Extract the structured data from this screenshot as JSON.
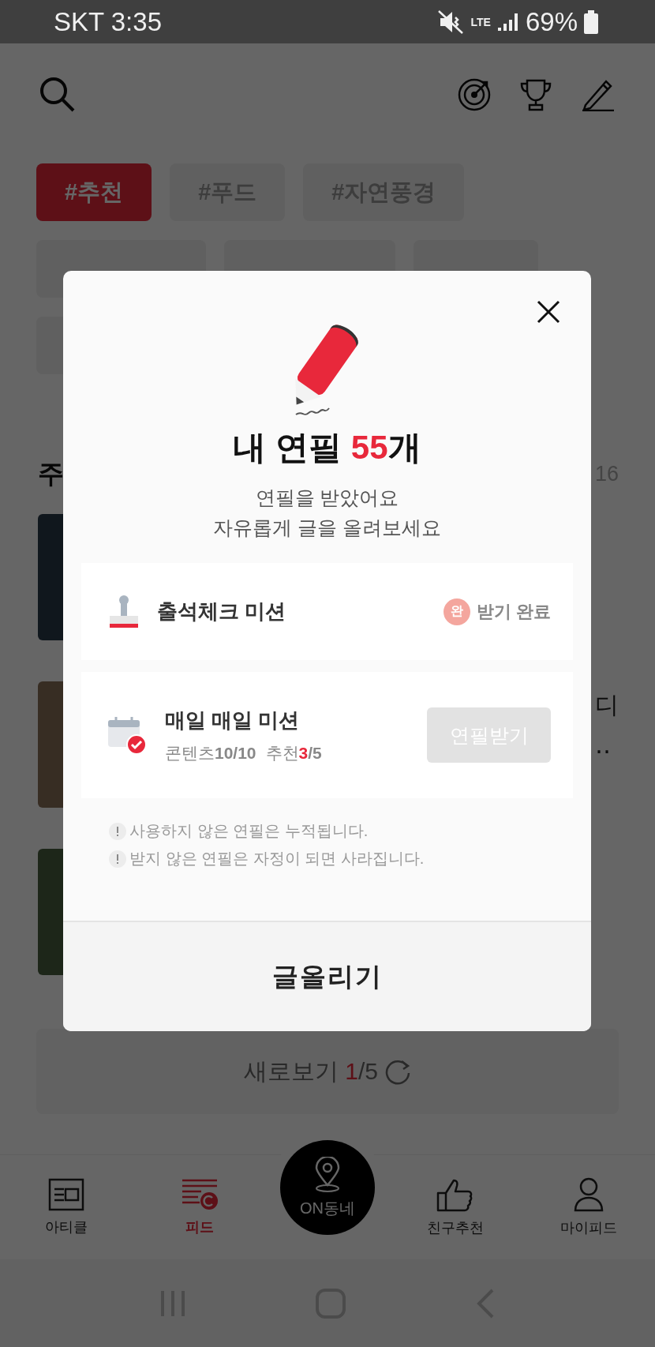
{
  "status_bar": {
    "carrier_time": "SKT 3:35",
    "network": "LTE",
    "battery": "69%"
  },
  "tags": [
    {
      "label": "#추천",
      "selected": true
    },
    {
      "label": "#푸드",
      "selected": false
    },
    {
      "label": "#자연풍경",
      "selected": false
    }
  ],
  "section": {
    "title": "주",
    "count": "16"
  },
  "feed_peek": {
    "line_1": "디",
    "line_2": "‥"
  },
  "refresh_button": {
    "label": "새로보기",
    "current": "1",
    "rest": "/5"
  },
  "bottom_nav": [
    {
      "kind": "tab",
      "label": "아티클",
      "selected": false
    },
    {
      "kind": "tab",
      "label": "피드",
      "selected": true
    },
    {
      "kind": "center",
      "label": "ON동네",
      "selected": false
    },
    {
      "kind": "tab",
      "label": "친구추천",
      "selected": false
    },
    {
      "kind": "tab",
      "label": "마이피드",
      "selected": false
    }
  ],
  "modal": {
    "title": "내 연필 ",
    "count": "55",
    "unit": "개",
    "message": [
      "연필을 받았어요",
      "자유롭게 글을 올려보세요"
    ],
    "missions": [
      {
        "kind": "attendance",
        "title": "출석체크 미션",
        "badge": "완",
        "status": "받기 완료"
      },
      {
        "kind": "daily",
        "title": "매일 매일 미션",
        "progress": [
          {
            "label": "콘텐츠",
            "done": "10",
            "total": "/10",
            "complete": true
          },
          {
            "label": "추천",
            "done": "3",
            "total": "/5",
            "complete": false
          }
        ],
        "button": {
          "label": "연필받기",
          "disabled": true
        }
      }
    ],
    "notes": [
      "사용하지 않은 연필은 누적됩니다.",
      "받지 않은 연필은 자정이 되면 사라집니다."
    ],
    "action": "글올리기"
  }
}
